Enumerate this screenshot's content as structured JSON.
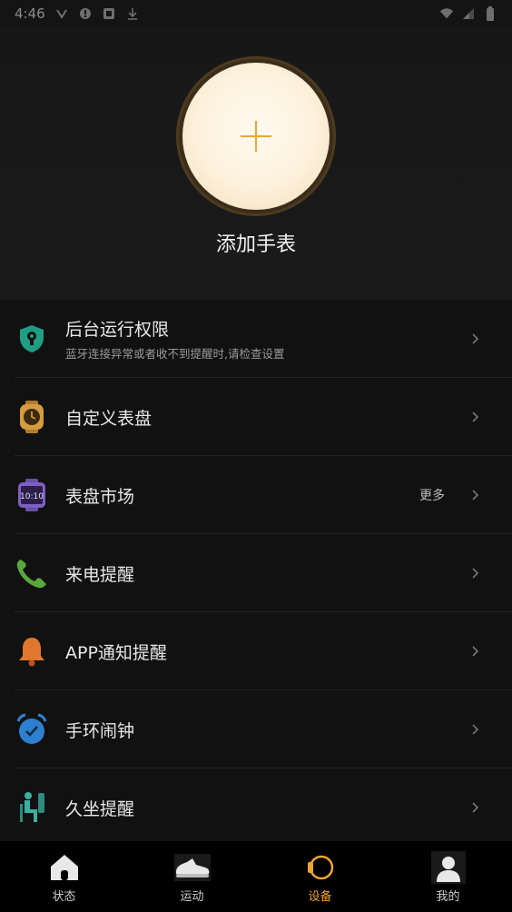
{
  "status_bar": {
    "time": "4:46"
  },
  "hero": {
    "title": "添加手表"
  },
  "menu": {
    "items": [
      {
        "title": "后台运行权限",
        "subtitle": "蓝牙连接异常或者收不到提醒时,请检查设置",
        "extra": "",
        "icon": "shield-lock-icon"
      },
      {
        "title": "自定义表盘",
        "subtitle": "",
        "extra": "",
        "icon": "watch-face-icon"
      },
      {
        "title": "表盘市场",
        "subtitle": "",
        "extra": "更多",
        "icon": "watch-market-icon",
        "icon_text": "10:10"
      },
      {
        "title": "来电提醒",
        "subtitle": "",
        "extra": "",
        "icon": "phone-icon"
      },
      {
        "title": "APP通知提醒",
        "subtitle": "",
        "extra": "",
        "icon": "bell-icon"
      },
      {
        "title": "手环闹钟",
        "subtitle": "",
        "extra": "",
        "icon": "alarm-clock-icon"
      },
      {
        "title": "久坐提醒",
        "subtitle": "",
        "extra": "",
        "icon": "sitting-icon"
      }
    ]
  },
  "tabbar": {
    "tabs": [
      {
        "label": "状态",
        "icon": "home-icon",
        "active": false
      },
      {
        "label": "运动",
        "icon": "sneaker-icon",
        "active": false
      },
      {
        "label": "设备",
        "icon": "watch-icon",
        "active": true
      },
      {
        "label": "我的",
        "icon": "profile-icon",
        "active": false
      }
    ]
  },
  "colors": {
    "accent": "#f0a531",
    "background": "#141414",
    "tabbar": "#000000"
  }
}
